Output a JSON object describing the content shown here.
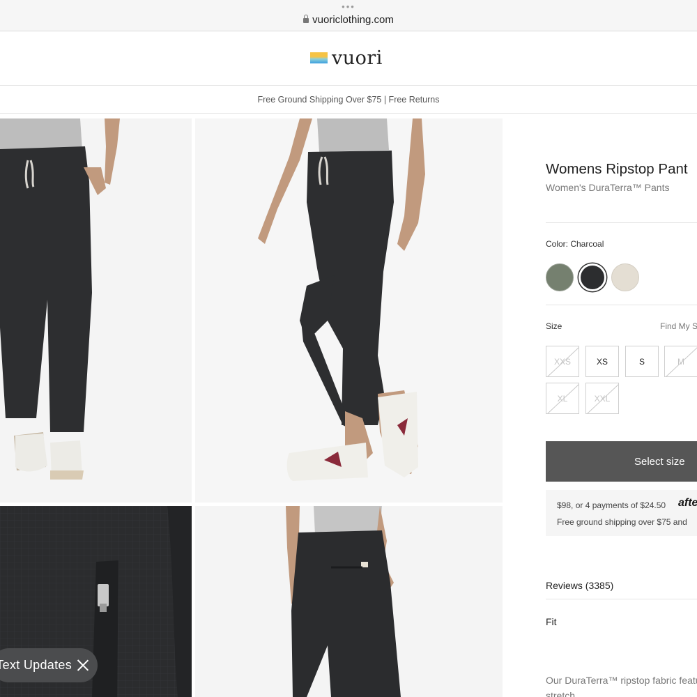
{
  "browser": {
    "dots": "•••",
    "url": "vuoriclothing.com"
  },
  "header": {
    "logo_text": "vuori"
  },
  "promo": {
    "text": "Free Ground Shipping Over $75 | Free Returns"
  },
  "popup": {
    "label": "Text Updates"
  },
  "product": {
    "title": "Womens Ripstop Pant",
    "subtitle": "Women's DuraTerra™ Pants",
    "color_label": "Color: Charcoal",
    "swatches": [
      {
        "name": "Green",
        "color": "#75806f"
      },
      {
        "name": "Charcoal",
        "color": "#2c2d2f",
        "selected": true
      },
      {
        "name": "Stone",
        "color": "#e4ded3"
      }
    ],
    "size_label": "Size",
    "size_guide": "Find My Size",
    "sizes": [
      {
        "label": "XXS",
        "available": false
      },
      {
        "label": "XS",
        "available": true
      },
      {
        "label": "S",
        "available": true
      },
      {
        "label": "M",
        "available": false
      },
      {
        "label": "XL",
        "available": false
      },
      {
        "label": "XXL",
        "available": false
      }
    ],
    "cta": "Select size",
    "payment": {
      "line1": "$98, or 4 payments of $24.50",
      "brand": "afterpay",
      "line2": "Free ground shipping over $75 and"
    },
    "reviews": "Reviews (3385)",
    "fit": "Fit",
    "description": "Our DuraTerra™ ripstop fabric features stretch"
  },
  "colors": {
    "brand_text": "#222222",
    "cta_bg": "#565656",
    "muted_text": "#777777"
  }
}
